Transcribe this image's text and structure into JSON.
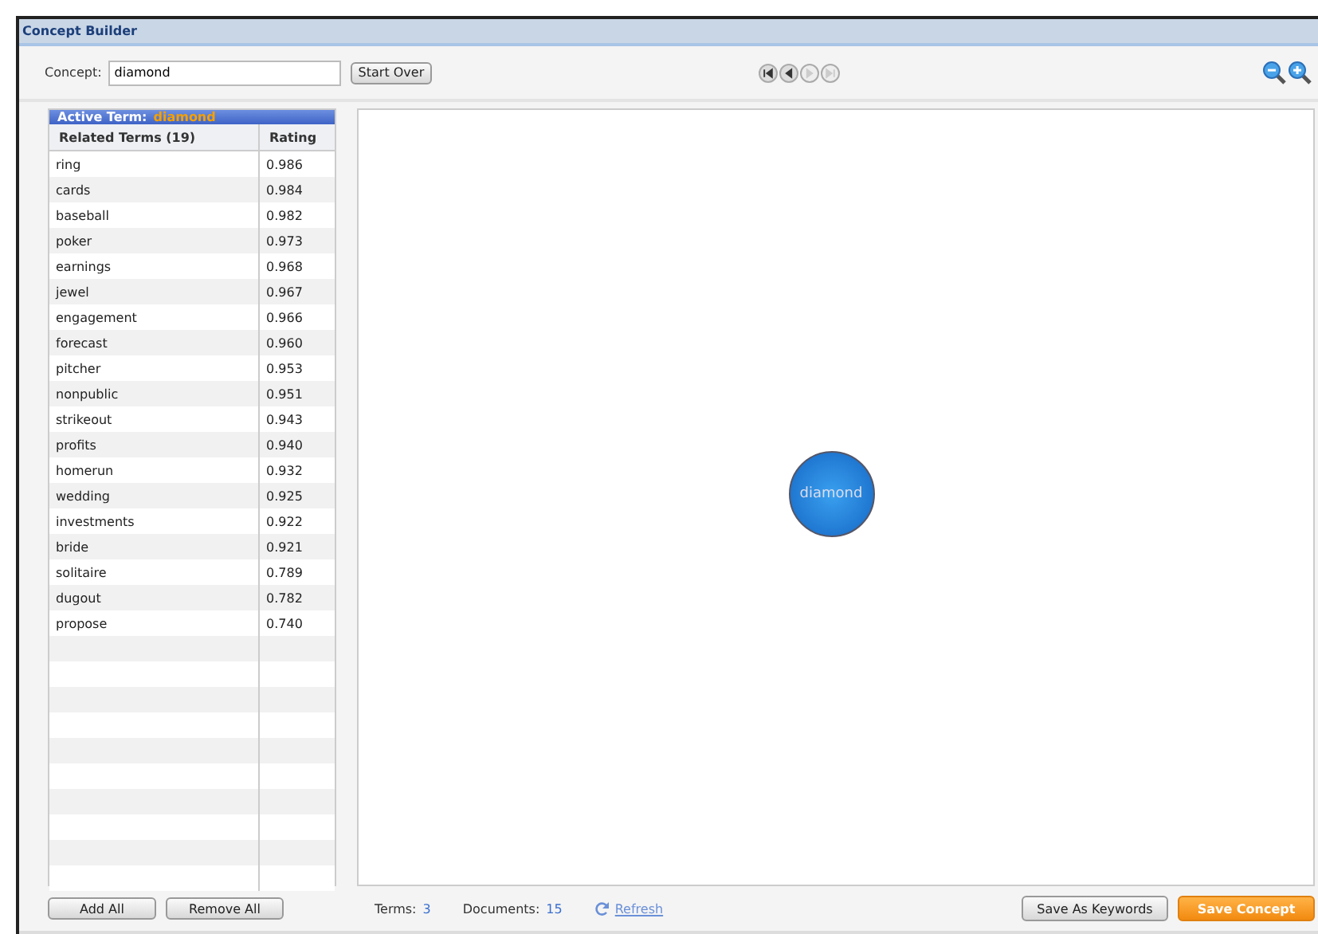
{
  "window": {
    "title": "Concept Builder"
  },
  "concept": {
    "label": "Concept:",
    "value": "diamond"
  },
  "start_over": "Start Over",
  "nav_buttons": [
    {
      "kind": "first",
      "disabled": false
    },
    {
      "kind": "prev",
      "disabled": false
    },
    {
      "kind": "next",
      "disabled": true
    },
    {
      "kind": "last",
      "disabled": true
    }
  ],
  "active_term": {
    "label": "Active Term:",
    "value": "diamond"
  },
  "table": {
    "columns": [
      "Related Terms (19)",
      "Rating"
    ],
    "rows": [
      [
        "ring",
        "0.986"
      ],
      [
        "cards",
        "0.984"
      ],
      [
        "baseball",
        "0.982"
      ],
      [
        "poker",
        "0.973"
      ],
      [
        "earnings",
        "0.968"
      ],
      [
        "jewel",
        "0.967"
      ],
      [
        "engagement",
        "0.966"
      ],
      [
        "forecast",
        "0.960"
      ],
      [
        "pitcher",
        "0.953"
      ],
      [
        "nonpublic",
        "0.951"
      ],
      [
        "strikeout",
        "0.943"
      ],
      [
        "profits",
        "0.940"
      ],
      [
        "homerun",
        "0.932"
      ],
      [
        "wedding",
        "0.925"
      ],
      [
        "investments",
        "0.922"
      ],
      [
        "bride",
        "0.921"
      ],
      [
        "solitaire",
        "0.789"
      ],
      [
        "dugout",
        "0.782"
      ],
      [
        "propose",
        "0.740"
      ]
    ]
  },
  "graph": {
    "node": "diamond"
  },
  "footer": {
    "add_all": "Add All",
    "remove_all": "Remove All",
    "terms_label": "Terms:",
    "terms": "3",
    "documents_label": "Documents:",
    "documents": "15",
    "refresh": "Refresh",
    "save_keywords": "Save As Keywords",
    "save_concept": "Save Concept"
  }
}
